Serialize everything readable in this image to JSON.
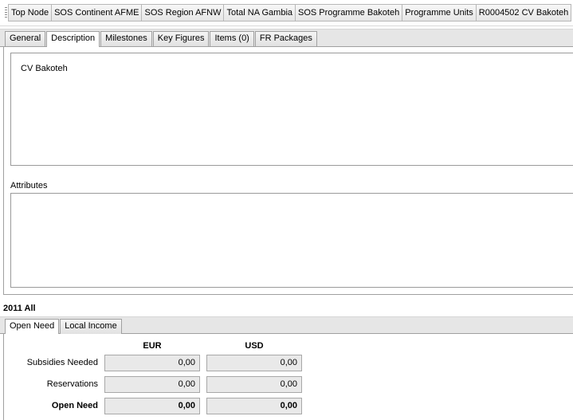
{
  "breadcrumb": {
    "items": [
      "Top Node",
      "SOS Continent AFME",
      "SOS Region AFNW",
      "Total NA Gambia",
      "SOS Programme Bakoteh",
      "Programme Units",
      "R0004502 CV Bakoteh"
    ]
  },
  "tabs": [
    "General",
    "Description",
    "Milestones",
    "Key Figures",
    "Items (0)",
    "FR Packages"
  ],
  "active_tab": "Description",
  "description": {
    "text": "CV Bakoteh"
  },
  "attributes": {
    "label": "Attributes",
    "text": ""
  },
  "year_heading": "2011 All",
  "bottom_tabs": [
    "Open Need",
    "Local Income"
  ],
  "bottom_active_tab": "Open Need",
  "open_need": {
    "columns": [
      "EUR",
      "USD"
    ],
    "rows": [
      {
        "label": "Subsidies Needed",
        "eur": "0,00",
        "usd": "0,00"
      },
      {
        "label": "Reservations",
        "eur": "0,00",
        "usd": "0,00"
      },
      {
        "label": "Open Need",
        "eur": "0,00",
        "usd": "0,00"
      }
    ]
  }
}
